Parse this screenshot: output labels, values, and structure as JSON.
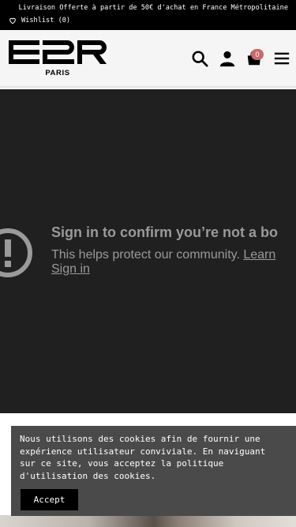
{
  "topbar": {
    "promo": "Livraison Offerte à partir de 50€ d'achat en France Métropolitaine",
    "wishlist": "Wishlist (0)",
    "wishlist_icon": "heart-outline-icon"
  },
  "header": {
    "logo_text": "E2R",
    "logo_subtext": "PARIS",
    "icons": [
      "search-icon",
      "user-icon",
      "cart-icon",
      "hamburger-menu-icon"
    ],
    "cart_count": "0",
    "badge_color": "#c96a6a"
  },
  "video": {
    "title": "Sign in to confirm you’re not a bo",
    "desc_prefix": "This helps protect our community. ",
    "learn_link": "Learn",
    "signin_link": "Sign in",
    "icon": "warning-circle-icon",
    "background": "#202020"
  },
  "cookie": {
    "message": "Nous utilisons des cookies afin de fournir une expérience utilisateur conviviale. En naviguant sur ce site, vous acceptez la politique d'utilisation des cookies.",
    "accept_label": "Accept",
    "background": "#4a4a4a"
  }
}
